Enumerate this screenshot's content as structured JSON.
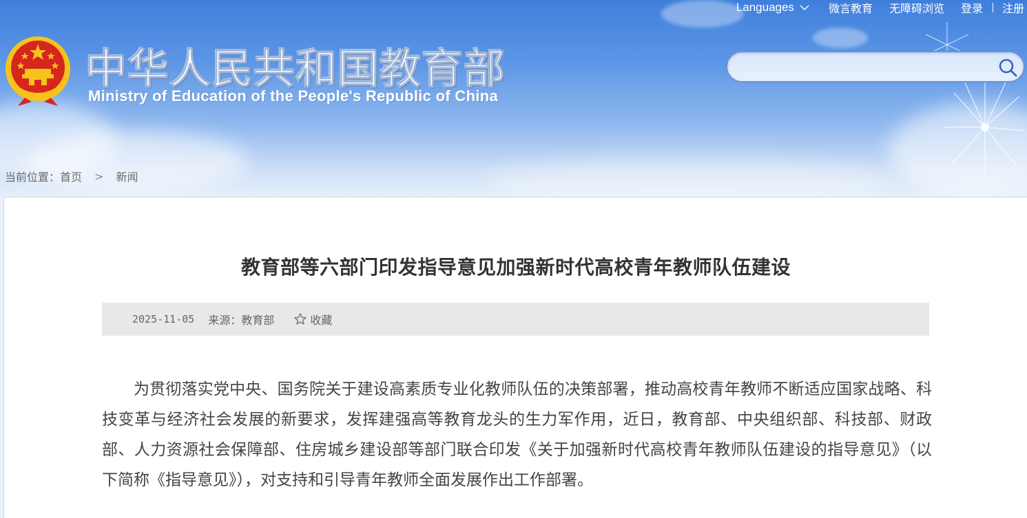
{
  "topbar": {
    "languages_label": "Languages",
    "links": [
      "微言教育",
      "无障碍浏览",
      "登录",
      "注册"
    ]
  },
  "header": {
    "title_cn": "中华人民共和国教育部",
    "title_en": "Ministry of Education of the People's Republic of China",
    "search": {
      "placeholder": "",
      "value": ""
    }
  },
  "breadcrumb": {
    "prefix": "当前位置：",
    "items": [
      "首页",
      "新闻"
    ],
    "separator": ">"
  },
  "article": {
    "title": "教育部等六部门印发指导意见加强新时代高校青年教师队伍建设",
    "date": "2025-11-05",
    "source": "来源：教育部",
    "favorite_label": "收藏",
    "paragraph": "为贯彻落实党中央、国务院关于建设高素质专业化教师队伍的决策部署，推动高校青年教师不断适应国家战略、科技变革与经济社会发展的新要求，发挥建强高等教育龙头的生力军作用，近日，教育部、中央组织部、科技部、财政部、人力资源社会保障部、住房城乡建设部等部门联合印发《关于加强新时代高校青年教师队伍建设的指导意见》（以下简称《指导意见》），对支持和引导青年教师全面发展作出工作部署。"
  },
  "colors": {
    "header_blue": "#3f7fdc",
    "emblem_red": "#d7261e",
    "emblem_gold": "#f6c21c",
    "meta_bar": "#e8e8e8",
    "title_text": "#333333"
  },
  "icons": [
    "national-emblem-icon",
    "chevron-down-icon",
    "search-icon",
    "star-icon"
  ]
}
